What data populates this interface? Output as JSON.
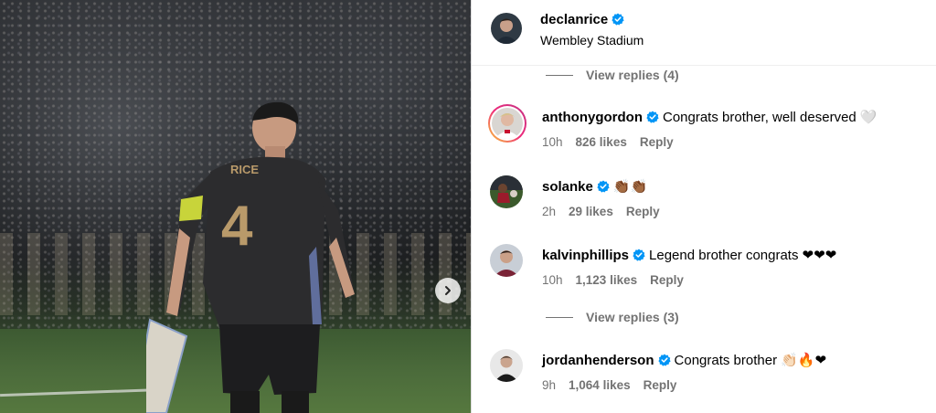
{
  "post": {
    "username": "declanrice",
    "location": "Wembley Stadium",
    "photo_number": "4",
    "photo_name": "RICE"
  },
  "view_replies": [
    {
      "label": "View replies (4)"
    },
    {
      "label": "View replies (3)"
    }
  ],
  "comments": [
    {
      "username": "anthonygordon",
      "text": "Congrats brother, well deserved 🤍",
      "time": "10h",
      "likes": "826 likes",
      "reply": "Reply"
    },
    {
      "username": "solanke",
      "text": "👏🏾👏🏾",
      "time": "2h",
      "likes": "29 likes",
      "reply": "Reply"
    },
    {
      "username": "kalvinphillips",
      "text": "Legend brother congrats ❤❤❤",
      "time": "10h",
      "likes": "1,123 likes",
      "reply": "Reply"
    },
    {
      "username": "jordanhenderson",
      "text": "Congrats brother 👏🏻🔥❤",
      "time": "9h",
      "likes": "1,064 likes",
      "reply": "Reply"
    }
  ],
  "icons": {
    "verified": "verified-badge-icon",
    "next": "chevron-right-icon"
  },
  "colors": {
    "verified": "#0095f6",
    "muted": "#737373",
    "story_ring_start": "#f9ce34",
    "story_ring_end": "#c13584"
  }
}
